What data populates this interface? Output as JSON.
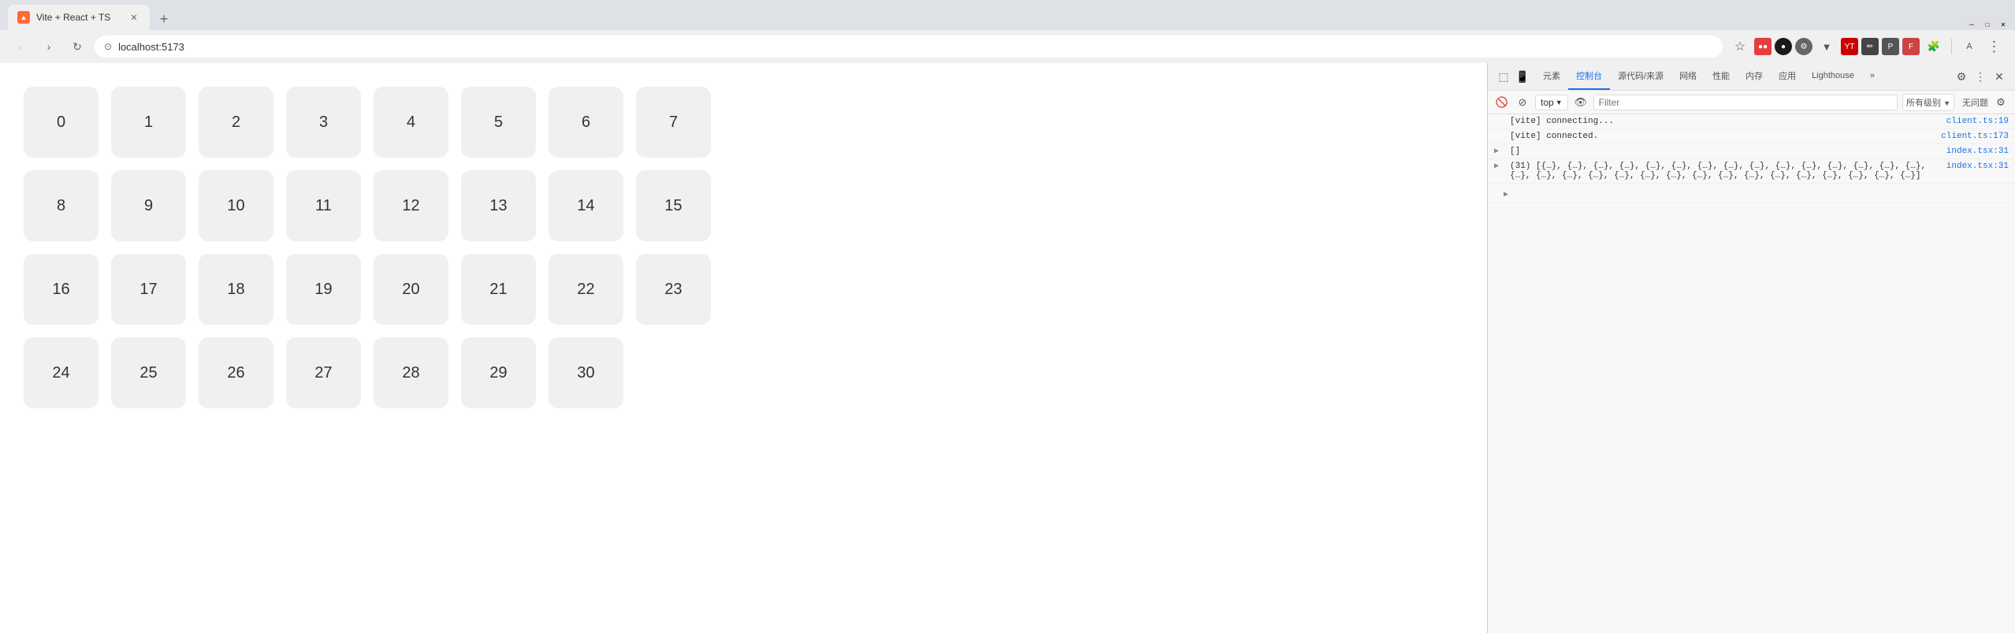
{
  "browser": {
    "tab_title": "Vite + React + TS",
    "tab_new_label": "+",
    "address": "localhost:5173",
    "nav_back": "‹",
    "nav_forward": "›",
    "nav_refresh": "↻",
    "favicon_text": "▲"
  },
  "webpage": {
    "grid_items": [
      0,
      1,
      2,
      3,
      4,
      5,
      6,
      7,
      8,
      9,
      10,
      11,
      12,
      13,
      14,
      15,
      16,
      17,
      18,
      19,
      20,
      21,
      22,
      23,
      24,
      25,
      26,
      27,
      28,
      29,
      30
    ]
  },
  "devtools": {
    "tabs": [
      "元素",
      "控制台",
      "源代码/来源",
      "网络",
      "性能",
      "内存",
      "应用",
      "Lighthouse",
      "»"
    ],
    "active_tab": "控制台",
    "context": "top",
    "filter_placeholder": "Filter",
    "log_level": "所有级别",
    "issues": "无问题",
    "console_lines": [
      {
        "type": "info",
        "text": "[vite] connecting...",
        "link": "client.ts:19"
      },
      {
        "type": "info",
        "text": "[vite] connected.",
        "link": "client.ts:173"
      },
      {
        "type": "log",
        "prefix": "▶",
        "text": "[]",
        "link": "index.tsx:31"
      },
      {
        "type": "log",
        "prefix": "▶",
        "text": "(31) [{…}, {…}, {…}, {…}, {…}, {…}, {…}, {…}, {…}, {…}, {…}, {…}, {…}, {…}, {…}, {…}, {…}, {…}, {…}, {…}, {…}, {…}, {…}, {…}, {…}, {…}, {…}, {…}, {…}, {…}, {…}]",
        "text2": "{…}, {…}, {…}, {…}, {…}, {…}, {…}, {…}, {…}, {…}, {…}, {…}]",
        "link": "index.tsx:31"
      }
    ]
  }
}
